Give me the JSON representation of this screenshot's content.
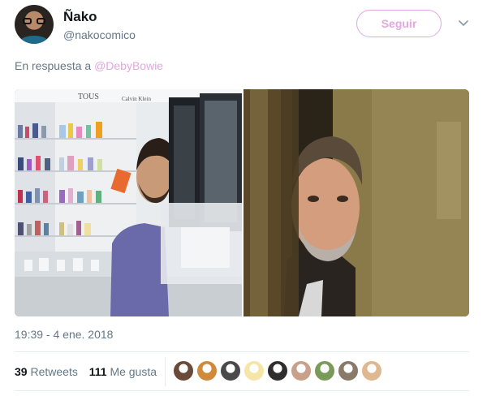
{
  "author": {
    "name": "Ñako",
    "handle": "@nakocomico",
    "avatar_icon": "profile-avatar"
  },
  "follow_button": {
    "label": "Seguir",
    "color": "#e0a8de"
  },
  "menu_icon": "chevron-down-icon",
  "reply_line": {
    "prefix": "En respuesta a",
    "mention": "@DebyBowie"
  },
  "media": {
    "left_panel_signs": [
      "TOUS",
      "Calvin Klein"
    ]
  },
  "timestamp": "19:39 - 4 ene. 2018",
  "stats": {
    "retweets_count": "39",
    "retweets_label": "Retweets",
    "likes_count": "111",
    "likes_label": "Me gusta"
  },
  "likers": [
    {
      "icon": "liker-avatar-1",
      "color": "#6b4a3a"
    },
    {
      "icon": "liker-avatar-2",
      "color": "#d08a3a"
    },
    {
      "icon": "liker-avatar-apple",
      "color": "#4a4a4a"
    },
    {
      "icon": "liker-avatar-emoji",
      "color": "#f5e6a8"
    },
    {
      "icon": "liker-avatar-5",
      "color": "#2e2e2e"
    },
    {
      "icon": "liker-avatar-6",
      "color": "#c9a08a"
    },
    {
      "icon": "liker-avatar-7",
      "color": "#7a9a5a"
    },
    {
      "icon": "liker-avatar-8",
      "color": "#8a7a6a"
    },
    {
      "icon": "liker-avatar-9",
      "color": "#e0b890"
    }
  ]
}
